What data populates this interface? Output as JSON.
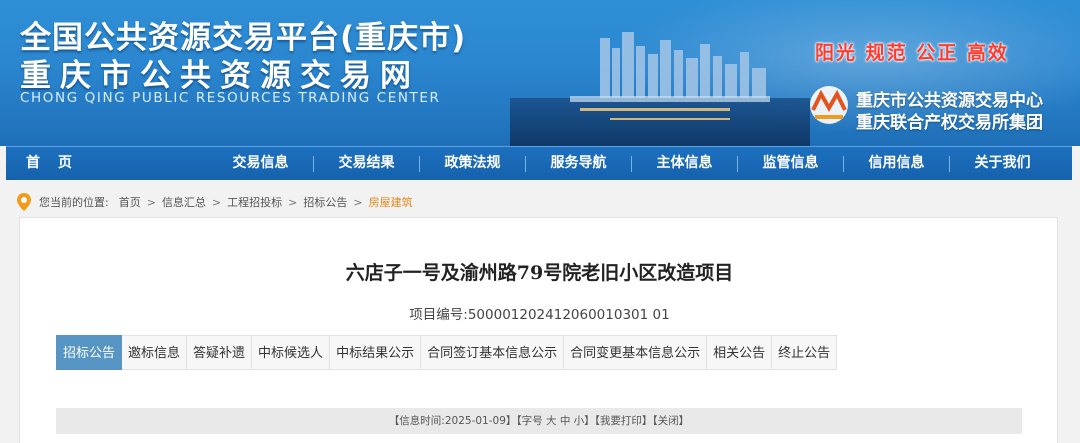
{
  "header": {
    "title_cn_line1": "全国公共资源交易平台(重庆市)",
    "title_cn_line2": "重庆市公共资源交易网",
    "title_en": "CHONG QING PUBLIC RESOURCES TRADING CENTER",
    "slogan": "阳光 规范 公正 高效",
    "org_line1": "重庆市公共资源交易中心",
    "org_line2": "重庆联合产权交易所集团"
  },
  "nav": {
    "home": "首页",
    "items": [
      "交易信息",
      "交易结果",
      "政策法规",
      "服务导航",
      "主体信息",
      "监管信息",
      "信用信息",
      "关于我们"
    ]
  },
  "breadcrumb": {
    "prefix": "您当前的位置:",
    "items": [
      "首页",
      "信息汇总",
      "工程招投标",
      "招标公告"
    ],
    "current": "房屋建筑"
  },
  "article": {
    "title": "六店子一号及渝州路79号院老旧小区改造项目",
    "project_no": "项目编号:500001202412060010301 01"
  },
  "tabs": [
    "招标公告",
    "邀标信息",
    "答疑补遗",
    "中标候选人",
    "中标结果公示",
    "合同签订基本信息公示",
    "合同变更基本信息公示",
    "相关公告",
    "终止公告"
  ],
  "info_bar": {
    "time_prefix": "【信息时间:",
    "time_value": "2025-01-09",
    "time_suffix": "】",
    "font_label": "【字号",
    "font_large": "大",
    "font_medium": "中",
    "font_small": "小",
    "font_suffix": "】",
    "print": "【我要打印】",
    "close": "【关闭】"
  },
  "colors": {
    "header_blue": "#2a86cf",
    "nav_blue": "#1562ad",
    "slogan_red": "#ff3b30",
    "active_tab": "#5795c4",
    "breadcrumb_current": "#e08a1e"
  },
  "icons": [
    "location-pin-icon",
    "organization-logo-icon"
  ]
}
